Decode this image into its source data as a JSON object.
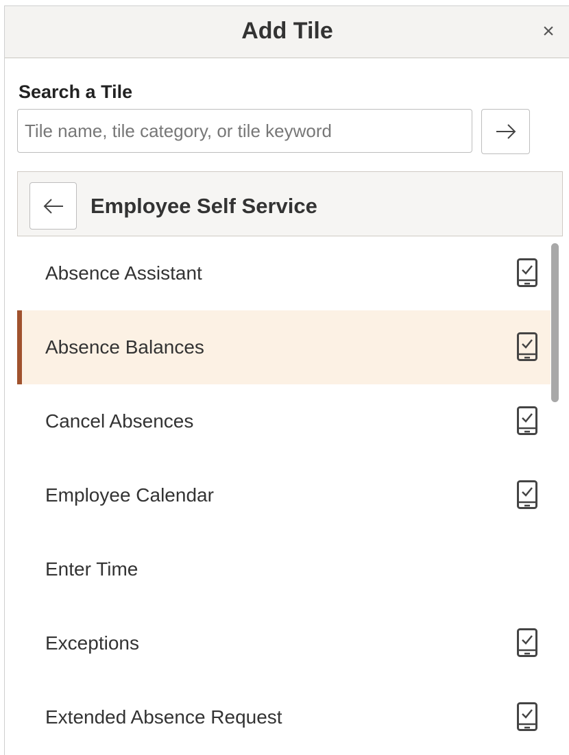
{
  "header": {
    "title": "Add Tile",
    "close_symbol": "×"
  },
  "search": {
    "label": "Search a Tile",
    "value": "",
    "placeholder": "Tile name, tile category, or tile keyword",
    "go_icon": "arrow-right-icon"
  },
  "category": {
    "back_icon": "arrow-left-icon",
    "title": "Employee Self Service"
  },
  "tiles": [
    {
      "label": "Absence Assistant",
      "mobile_icon": true,
      "selected": false
    },
    {
      "label": "Absence Balances",
      "mobile_icon": true,
      "selected": true
    },
    {
      "label": "Cancel Absences",
      "mobile_icon": true,
      "selected": false
    },
    {
      "label": "Employee Calendar",
      "mobile_icon": true,
      "selected": false
    },
    {
      "label": "Enter Time",
      "mobile_icon": false,
      "selected": false
    },
    {
      "label": "Exceptions",
      "mobile_icon": true,
      "selected": false
    },
    {
      "label": "Extended Absence Request",
      "mobile_icon": true,
      "selected": false
    }
  ],
  "colors": {
    "selected_background": "#fcf1e4",
    "selected_accent": "#a0522d",
    "header_background": "#f4f3f1"
  }
}
